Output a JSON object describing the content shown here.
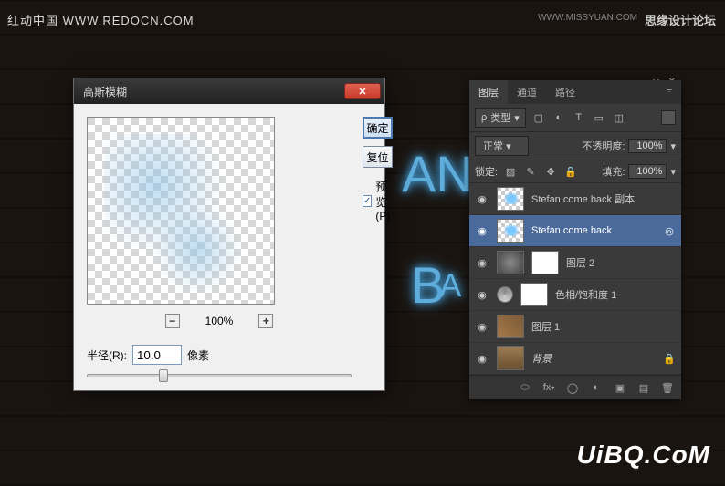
{
  "watermarks": {
    "top_left": "红动中国  WWW.REDOCN.COM",
    "top_right_label": "思缘设计论坛",
    "top_right_url": "WWW.MISSYUAN.COM",
    "bottom_right": "UiBQ.CoM"
  },
  "neon": {
    "text1": "AN",
    "text2": "B",
    "text2b": "A"
  },
  "dialog": {
    "title": "高斯模糊",
    "ok": "确定",
    "reset": "复位",
    "preview_label": "预览(P)",
    "zoom_out": "−",
    "zoom_pct": "100%",
    "zoom_in": "+",
    "radius_label": "半径(R):",
    "radius_value": "10.0",
    "radius_unit": "像素",
    "close": "✕"
  },
  "panel": {
    "tabs": {
      "layers": "图层",
      "channels": "通道",
      "paths": "路径"
    },
    "kind_prefix": "ρ",
    "kind_label": "类型",
    "blend_mode": "正常",
    "opacity_label": "不透明度:",
    "opacity_value": "100%",
    "lock_label": "锁定:",
    "fill_label": "填充:",
    "fill_value": "100%",
    "collapse": "◂◂",
    "close": "✕"
  },
  "layers": [
    {
      "name": "Stefan  come back 副本",
      "selected": false,
      "thumb": "neonth",
      "mask": false,
      "eye": true
    },
    {
      "name": "Stefan  come back",
      "selected": true,
      "thumb": "neonth",
      "mask": false,
      "eye": true,
      "meta": true
    },
    {
      "name": "图层 2",
      "selected": false,
      "thumb": "grey",
      "mask": true,
      "eye": true
    },
    {
      "name": "色相/饱和度 1",
      "selected": false,
      "thumb": "adj",
      "mask": true,
      "eye": true
    },
    {
      "name": "图层 1",
      "selected": false,
      "thumb": "texture",
      "mask": false,
      "eye": true
    },
    {
      "name": "背景",
      "selected": false,
      "thumb": "bg",
      "mask": false,
      "eye": true,
      "locked": true
    }
  ],
  "icons": {
    "eye": "◉",
    "search": "🔍",
    "image": "▢",
    "adjust": "◐",
    "type": "T",
    "shape": "▭",
    "smart": "◫",
    "menu": "☰",
    "transparent": "▨",
    "brush": "✎",
    "move": "✥",
    "lock": "🔒",
    "arrow": "▾",
    "link_meta": "◎",
    "fx": "fx",
    "link": "⬭",
    "fx2": "fx",
    "mask": "◯",
    "adj": "◐",
    "group": "▣",
    "new": "▤",
    "trash": "🗑",
    "chev": "÷"
  }
}
